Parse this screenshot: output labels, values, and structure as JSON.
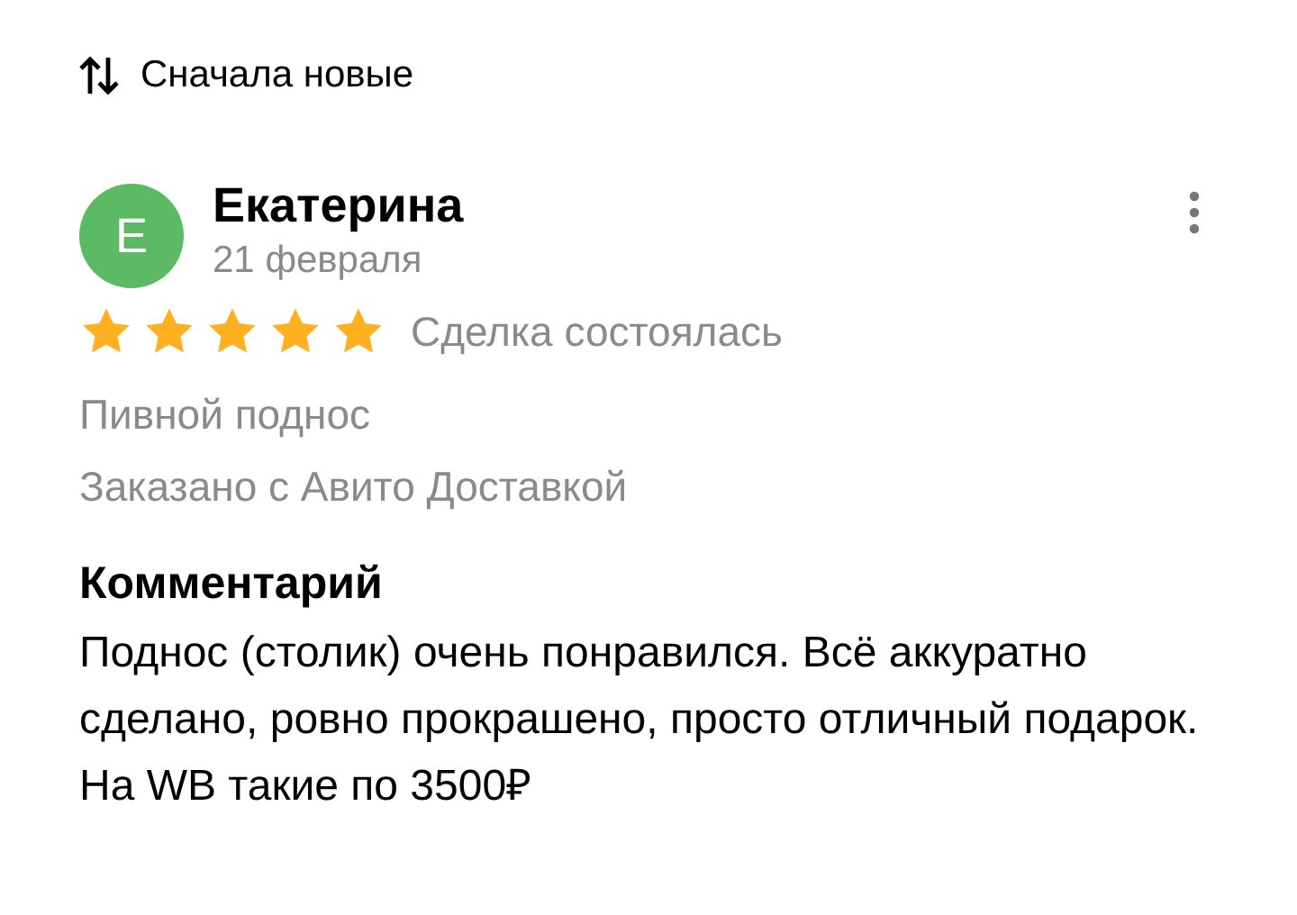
{
  "sort": {
    "label": "Сначала новые"
  },
  "review": {
    "avatar_letter": "Е",
    "author": "Екатерина",
    "date": "21 февраля",
    "stars": 5,
    "deal_status": "Сделка состоялась",
    "item": "Пивной поднос",
    "delivery": "Заказано с Авито Доставкой",
    "comment_title": "Комментарий",
    "comment": "Поднос (столик) очень понравился. Всё аккуратно сделано, ровно прокрашено, просто отличный подарок. На WB такие по 3500₽"
  }
}
